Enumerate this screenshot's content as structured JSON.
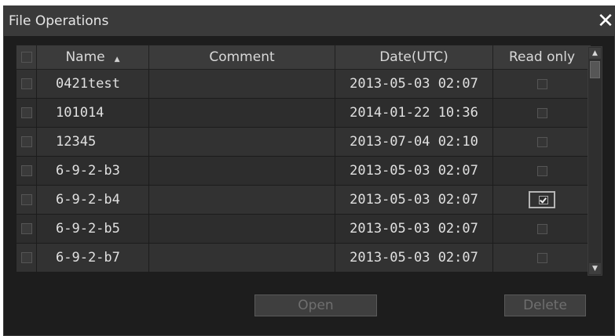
{
  "window": {
    "title": "File Operations"
  },
  "table": {
    "columns": {
      "name": "Name",
      "comment": "Comment",
      "date": "Date(UTC)",
      "read_only": "Read only"
    },
    "rows": [
      {
        "name": "0421test",
        "comment": "",
        "date": "2013-05-03 02:07",
        "read_only": false
      },
      {
        "name": "101014",
        "comment": "",
        "date": "2014-01-22 10:36",
        "read_only": false
      },
      {
        "name": "12345",
        "comment": "",
        "date": "2013-07-04 02:10",
        "read_only": false
      },
      {
        "name": "6-9-2-b3",
        "comment": "",
        "date": "2013-05-03 02:07",
        "read_only": false
      },
      {
        "name": "6-9-2-b4",
        "comment": "",
        "date": "2013-05-03 02:07",
        "read_only": true
      },
      {
        "name": "6-9-2-b5",
        "comment": "",
        "date": "2013-05-03 02:07",
        "read_only": false
      },
      {
        "name": "6-9-2-b7",
        "comment": "",
        "date": "2013-05-03 02:07",
        "read_only": false
      }
    ]
  },
  "buttons": {
    "open": "Open",
    "delete": "Delete"
  },
  "icons": {
    "close": "close-icon",
    "sort": "sort-ascending-icon",
    "scroll_up": "scroll-up-icon",
    "scroll_down": "scroll-down-icon"
  }
}
